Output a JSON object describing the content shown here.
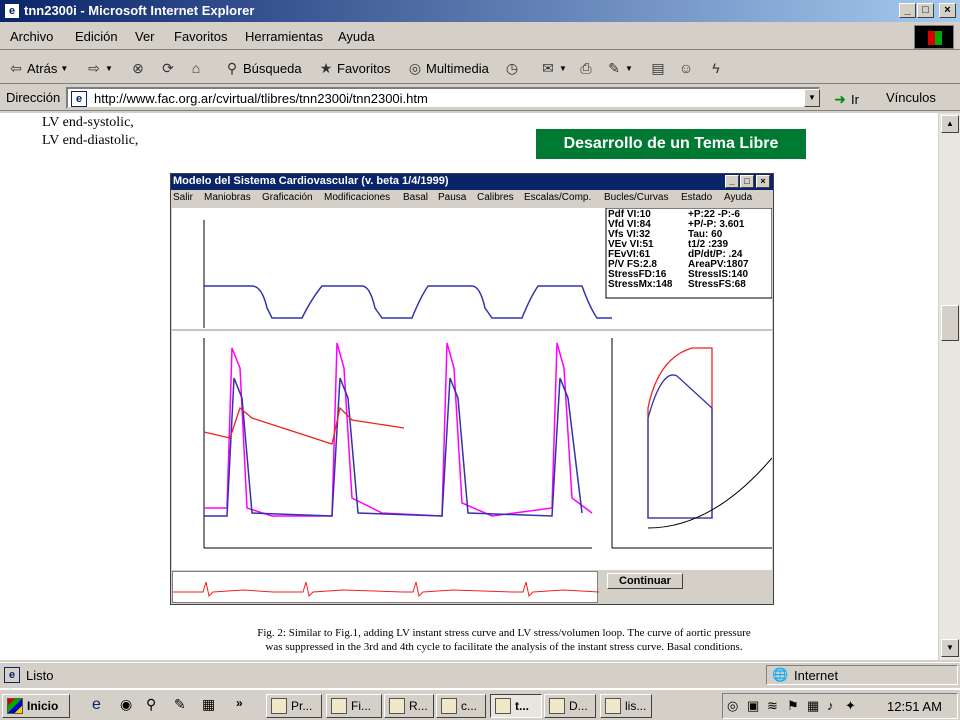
{
  "window": {
    "title": "tnn2300i - Microsoft Internet Explorer"
  },
  "menu": [
    "Archivo",
    "Edición",
    "Ver",
    "Favoritos",
    "Herramientas",
    "Ayuda"
  ],
  "toolbar": {
    "back": "Atrás",
    "search": "Búsqueda",
    "favorites": "Favoritos",
    "multimedia": "Multimedia"
  },
  "address": {
    "label": "Dirección",
    "url": "http://www.fac.org.ar/cvirtual/tlibres/tnn2300i/tnn2300i.htm",
    "go": "Ir",
    "links": "Vínculos"
  },
  "page": {
    "text_line1": "LV end-systolic,",
    "text_line2": "LV end-diastolic,",
    "banner": "Desarrollo de un Tema Libre",
    "caption_line1": "Fig. 2: Similar to Fig.1, adding LV instant stress curve and LV stress/volumen loop. The curve of aortic pressure",
    "caption_line2": "was suppressed in the 3rd and 4th cycle to facilitate the analysis of the instant stress curve. Basal conditions."
  },
  "simulator": {
    "title": "Modelo del Sistema Cardiovascular (v. beta 1/4/1999)",
    "menu": [
      "Salir",
      "Maniobras",
      "Graficación",
      "Modificaciones",
      "Basal",
      "Pausa",
      "Calibres",
      "Escalas/Comp.",
      "Bucles/Curvas",
      "Estado",
      "Ayuda"
    ],
    "stats_left": [
      "Pdf VI:10",
      "Vfd VI:84",
      "Vfs VI:32",
      "VEv VI:51",
      "FEvVI:61",
      "P/V FS:2.8",
      "StressFD:16",
      "StressMx:148"
    ],
    "stats_right": [
      "+P:22 -P:-6",
      "+P/-P: 3.601",
      "Tau: 60",
      "t1/2 :239",
      "dP/dt/P: .24",
      "AreaPV:1807",
      "StressIS:140",
      "StressFS:68"
    ],
    "continue_button": "Continuar",
    "colors": {
      "titlebar": "#0a246a",
      "pressure": "#ff00ff",
      "volume": "#3333aa",
      "stress": "#ee2222"
    }
  },
  "status": {
    "left": "Listo",
    "zone": "Internet"
  },
  "taskbar": {
    "start": "Inicio",
    "tasks": [
      "Pr...",
      "Fi...",
      "R...",
      "c...",
      "t...",
      "D...",
      "lis..."
    ],
    "clock": "12:51 AM"
  }
}
